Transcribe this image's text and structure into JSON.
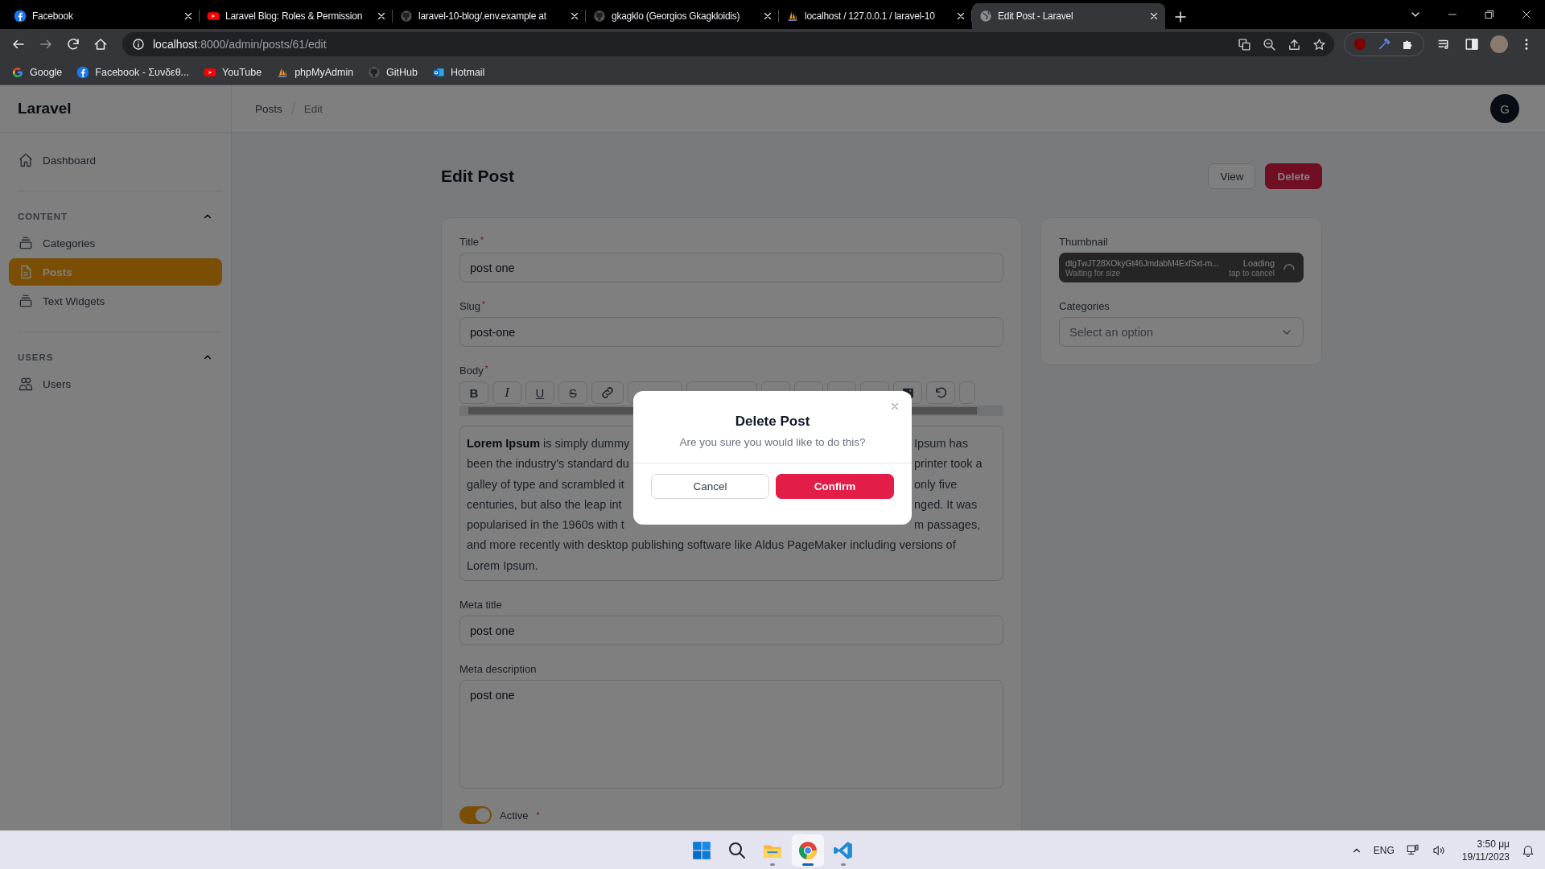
{
  "browser": {
    "tabs": [
      {
        "kind": "facebook",
        "title": "Facebook",
        "selected": false
      },
      {
        "kind": "youtube",
        "title": "Laravel Blog: Roles & Permission",
        "selected": false
      },
      {
        "kind": "github",
        "title": "laravel-10-blog/.env.example at",
        "selected": false
      },
      {
        "kind": "github",
        "title": "gkagklo (Georgios Gkagkloidis)",
        "selected": false
      },
      {
        "kind": "pma",
        "title": "localhost / 127.0.0.1 / laravel-10",
        "selected": false
      },
      {
        "kind": "globe",
        "title": "Edit Post - Laravel",
        "selected": true
      }
    ],
    "address": {
      "host": "localhost",
      "path": ":8000/admin/posts/61/edit"
    },
    "bookmarks": [
      {
        "kind": "google",
        "label": "Google"
      },
      {
        "kind": "facebook",
        "label": "Facebook - Συνδεθ..."
      },
      {
        "kind": "youtube",
        "label": "YouTube"
      },
      {
        "kind": "pma",
        "label": "phpMyAdmin"
      },
      {
        "kind": "github",
        "label": "GitHub"
      },
      {
        "kind": "outlook",
        "label": "Hotmail"
      }
    ]
  },
  "app": {
    "brand": "Laravel",
    "breadcrumbs": [
      "Posts",
      "Edit"
    ],
    "avatar": "G",
    "nav": {
      "top": [
        {
          "kind": "home",
          "label": "Dashboard",
          "selected": false
        }
      ],
      "groups": [
        {
          "label": "CONTENT",
          "expanded": true,
          "items": [
            {
              "kind": "stack",
              "label": "Categories",
              "selected": false
            },
            {
              "kind": "document",
              "label": "Posts",
              "selected": true
            },
            {
              "kind": "stack",
              "label": "Text Widgets",
              "selected": false
            }
          ]
        },
        {
          "label": "USERS",
          "expanded": true,
          "items": [
            {
              "kind": "users",
              "label": "Users",
              "selected": false
            }
          ]
        }
      ]
    },
    "page": {
      "title": "Edit Post",
      "actions": [
        {
          "kind": "secondary",
          "label": "View"
        },
        {
          "kind": "danger",
          "label": "Delete"
        }
      ]
    },
    "form": [
      {
        "kind": "text",
        "label": "Title",
        "required_mark": "*",
        "value": "post one"
      },
      {
        "kind": "text",
        "label": "Slug",
        "required_mark": "*",
        "value": "post-one"
      },
      {
        "kind": "editor",
        "label": "Body",
        "required_mark": "*",
        "toolbar": [
          {
            "kind": "bold",
            "label": "B"
          },
          {
            "kind": "italic",
            "label": "I"
          },
          {
            "kind": "underline",
            "label": "U"
          },
          {
            "kind": "strike",
            "label": "S"
          },
          {
            "kind": "link"
          },
          {
            "kind": "covered"
          },
          {
            "kind": "covered"
          },
          {
            "kind": "covered"
          },
          {
            "kind": "covered"
          },
          {
            "kind": "covered"
          },
          {
            "kind": "covered"
          },
          {
            "kind": "image"
          },
          {
            "kind": "undo"
          },
          {
            "kind": "covered"
          }
        ],
        "lines": [
          {
            "left": "**Lorem Ipsum** is simply dummy",
            "right": "Ipsum has"
          },
          {
            "left": "been the industry's standard du",
            "right": "printer took a"
          },
          {
            "left": "galley of type and scrambled it",
            "right": "only five"
          },
          {
            "left": "centuries, but also the leap int",
            "right": "nged. It was"
          },
          {
            "left": "popularised in the 1960s with t",
            "right": "m passages,"
          },
          {
            "left": "and more recently with desktop publishing software like Aldus PageMaker including versions of"
          },
          {
            "left": "Lorem Ipsum."
          }
        ]
      },
      {
        "kind": "text",
        "label": "Meta title",
        "value": "post one"
      },
      {
        "kind": "textarea",
        "label": "Meta description",
        "value": "post one"
      },
      {
        "kind": "toggle",
        "label": "Active",
        "required_mark": "*",
        "on": true
      }
    ],
    "side": {
      "thumbnail": {
        "label": "Thumbnail",
        "file": "dtgTwJT28XOkyGt46JmdabM4ExfSxt-m...",
        "status": "Waiting for size",
        "state": "Loading",
        "hint": "tap to cancel"
      },
      "categories": {
        "label": "Categories",
        "placeholder": "Select an option"
      }
    }
  },
  "modal": {
    "title": "Delete Post",
    "message": "Are you sure you would like to do this?",
    "actions": [
      {
        "kind": "secondary",
        "label": "Cancel"
      },
      {
        "kind": "danger",
        "label": "Confirm"
      }
    ]
  },
  "taskbar": {
    "apps": [
      {
        "kind": "start"
      },
      {
        "kind": "search"
      },
      {
        "kind": "files"
      },
      {
        "kind": "chrome"
      },
      {
        "kind": "code"
      }
    ],
    "language": "ENG",
    "time": "3:50 μμ",
    "date": "19/11/2023"
  }
}
